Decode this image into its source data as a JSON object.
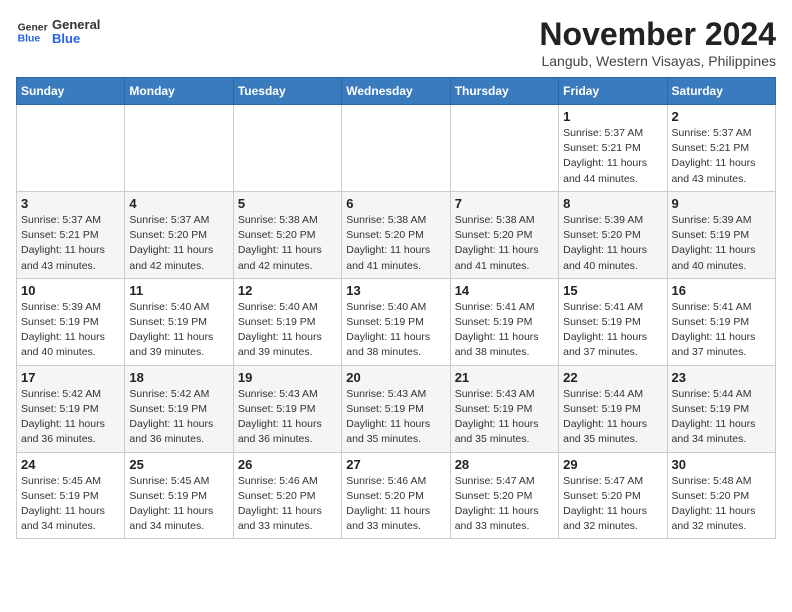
{
  "logo": {
    "line1": "General",
    "line2": "Blue"
  },
  "title": {
    "month_year": "November 2024",
    "location": "Langub, Western Visayas, Philippines"
  },
  "weekdays": [
    "Sunday",
    "Monday",
    "Tuesday",
    "Wednesday",
    "Thursday",
    "Friday",
    "Saturday"
  ],
  "weeks": [
    [
      {
        "day": "",
        "info": ""
      },
      {
        "day": "",
        "info": ""
      },
      {
        "day": "",
        "info": ""
      },
      {
        "day": "",
        "info": ""
      },
      {
        "day": "",
        "info": ""
      },
      {
        "day": "1",
        "info": "Sunrise: 5:37 AM\nSunset: 5:21 PM\nDaylight: 11 hours\nand 44 minutes."
      },
      {
        "day": "2",
        "info": "Sunrise: 5:37 AM\nSunset: 5:21 PM\nDaylight: 11 hours\nand 43 minutes."
      }
    ],
    [
      {
        "day": "3",
        "info": "Sunrise: 5:37 AM\nSunset: 5:21 PM\nDaylight: 11 hours\nand 43 minutes."
      },
      {
        "day": "4",
        "info": "Sunrise: 5:37 AM\nSunset: 5:20 PM\nDaylight: 11 hours\nand 42 minutes."
      },
      {
        "day": "5",
        "info": "Sunrise: 5:38 AM\nSunset: 5:20 PM\nDaylight: 11 hours\nand 42 minutes."
      },
      {
        "day": "6",
        "info": "Sunrise: 5:38 AM\nSunset: 5:20 PM\nDaylight: 11 hours\nand 41 minutes."
      },
      {
        "day": "7",
        "info": "Sunrise: 5:38 AM\nSunset: 5:20 PM\nDaylight: 11 hours\nand 41 minutes."
      },
      {
        "day": "8",
        "info": "Sunrise: 5:39 AM\nSunset: 5:20 PM\nDaylight: 11 hours\nand 40 minutes."
      },
      {
        "day": "9",
        "info": "Sunrise: 5:39 AM\nSunset: 5:19 PM\nDaylight: 11 hours\nand 40 minutes."
      }
    ],
    [
      {
        "day": "10",
        "info": "Sunrise: 5:39 AM\nSunset: 5:19 PM\nDaylight: 11 hours\nand 40 minutes."
      },
      {
        "day": "11",
        "info": "Sunrise: 5:40 AM\nSunset: 5:19 PM\nDaylight: 11 hours\nand 39 minutes."
      },
      {
        "day": "12",
        "info": "Sunrise: 5:40 AM\nSunset: 5:19 PM\nDaylight: 11 hours\nand 39 minutes."
      },
      {
        "day": "13",
        "info": "Sunrise: 5:40 AM\nSunset: 5:19 PM\nDaylight: 11 hours\nand 38 minutes."
      },
      {
        "day": "14",
        "info": "Sunrise: 5:41 AM\nSunset: 5:19 PM\nDaylight: 11 hours\nand 38 minutes."
      },
      {
        "day": "15",
        "info": "Sunrise: 5:41 AM\nSunset: 5:19 PM\nDaylight: 11 hours\nand 37 minutes."
      },
      {
        "day": "16",
        "info": "Sunrise: 5:41 AM\nSunset: 5:19 PM\nDaylight: 11 hours\nand 37 minutes."
      }
    ],
    [
      {
        "day": "17",
        "info": "Sunrise: 5:42 AM\nSunset: 5:19 PM\nDaylight: 11 hours\nand 36 minutes."
      },
      {
        "day": "18",
        "info": "Sunrise: 5:42 AM\nSunset: 5:19 PM\nDaylight: 11 hours\nand 36 minutes."
      },
      {
        "day": "19",
        "info": "Sunrise: 5:43 AM\nSunset: 5:19 PM\nDaylight: 11 hours\nand 36 minutes."
      },
      {
        "day": "20",
        "info": "Sunrise: 5:43 AM\nSunset: 5:19 PM\nDaylight: 11 hours\nand 35 minutes."
      },
      {
        "day": "21",
        "info": "Sunrise: 5:43 AM\nSunset: 5:19 PM\nDaylight: 11 hours\nand 35 minutes."
      },
      {
        "day": "22",
        "info": "Sunrise: 5:44 AM\nSunset: 5:19 PM\nDaylight: 11 hours\nand 35 minutes."
      },
      {
        "day": "23",
        "info": "Sunrise: 5:44 AM\nSunset: 5:19 PM\nDaylight: 11 hours\nand 34 minutes."
      }
    ],
    [
      {
        "day": "24",
        "info": "Sunrise: 5:45 AM\nSunset: 5:19 PM\nDaylight: 11 hours\nand 34 minutes."
      },
      {
        "day": "25",
        "info": "Sunrise: 5:45 AM\nSunset: 5:19 PM\nDaylight: 11 hours\nand 34 minutes."
      },
      {
        "day": "26",
        "info": "Sunrise: 5:46 AM\nSunset: 5:20 PM\nDaylight: 11 hours\nand 33 minutes."
      },
      {
        "day": "27",
        "info": "Sunrise: 5:46 AM\nSunset: 5:20 PM\nDaylight: 11 hours\nand 33 minutes."
      },
      {
        "day": "28",
        "info": "Sunrise: 5:47 AM\nSunset: 5:20 PM\nDaylight: 11 hours\nand 33 minutes."
      },
      {
        "day": "29",
        "info": "Sunrise: 5:47 AM\nSunset: 5:20 PM\nDaylight: 11 hours\nand 32 minutes."
      },
      {
        "day": "30",
        "info": "Sunrise: 5:48 AM\nSunset: 5:20 PM\nDaylight: 11 hours\nand 32 minutes."
      }
    ]
  ]
}
